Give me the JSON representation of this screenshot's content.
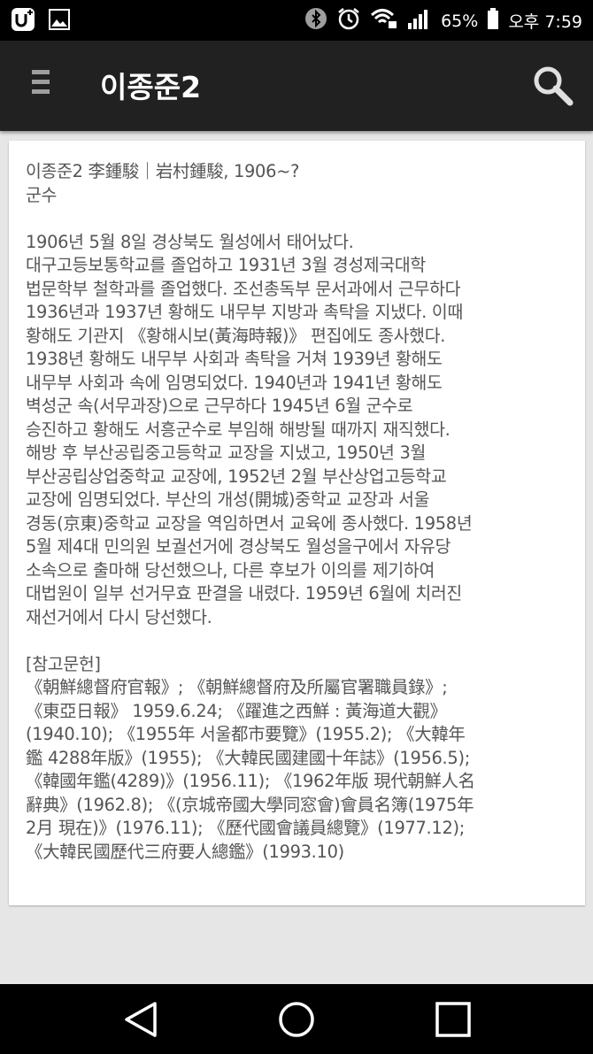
{
  "status_bar": {
    "battery_percent": "65%",
    "time": "오후 7:59",
    "icons": [
      "u-plus-icon",
      "image-icon",
      "bluetooth-icon",
      "alarm-icon",
      "wifi-lock-icon",
      "signal-icon",
      "battery-icon"
    ]
  },
  "app_bar": {
    "title": "이종준2",
    "menu_icon": "hamburger-menu-icon",
    "search_icon": "search-icon"
  },
  "article": {
    "text": "이종준2 李鍾駿｜岩村鍾駿, 1906~?\n군수\n\n1906년 5월 8일 경상북도 월성에서 태어났다.\n대구고등보통학교를 졸업하고 1931년 3월 경성제국대학\n법문학부 철학과를 졸업했다. 조선총독부 문서과에서 근무하다\n1936년과 1937년 황해도 내무부 지방과 촉탁을 지냈다. 이때\n황해도 기관지 《황해시보(黃海時報)》 편집에도 종사했다.\n1938년 황해도 내무부 사회과 촉탁을 거쳐 1939년 황해도\n내무부 사회과 속에 임명되었다. 1940년과 1941년 황해도\n벽성군 속(서무과장)으로 근무하다 1945년 6월 군수로\n승진하고 황해도 서흥군수로 부임해 해방될 때까지 재직했다.\n해방 후 부산공립중고등학교 교장을 지냈고, 1950년 3월\n부산공립상업중학교 교장에, 1952년 2월 부산상업고등학교\n교장에 임명되었다. 부산의 개성(開城)중학교 교장과 서울\n경동(京東)중학교 교장을 역임하면서 교육에 종사했다. 1958년\n5월 제4대 민의원 보궐선거에 경상북도 월성을구에서 자유당\n소속으로 출마해 당선했으나, 다른 후보가 이의를 제기하여\n대법원이 일부 선거무효 판결을 내렸다. 1959년 6월에 치러진\n재선거에서 다시 당선했다.\n\n[참고문헌]\n《朝鮮總督府官報》; 《朝鮮總督府及所屬官署職員錄》;\n《東亞日報》 1959.6.24; 《躍進之西鮮 : 黃海道大觀》\n(1940.10); 《1955年 서울都市要覽》(1955.2); 《大韓年\n鑑 4288年版》(1955); 《大韓民國建國十年誌》(1956.5);\n《韓國年鑑(4289)》(1956.11); 《1962年版 現代朝鮮人名\n辭典》(1962.8); 《(京城帝國大學同窓會)會員名簿(1975年\n2月 現在)》(1976.11); 《歷代國會議員總覽》(1977.12);\n《大韓民國歷代三府要人總鑑》(1993.10)"
  },
  "nav_bar": {
    "icons": [
      "back-icon",
      "home-icon",
      "recents-icon"
    ]
  }
}
